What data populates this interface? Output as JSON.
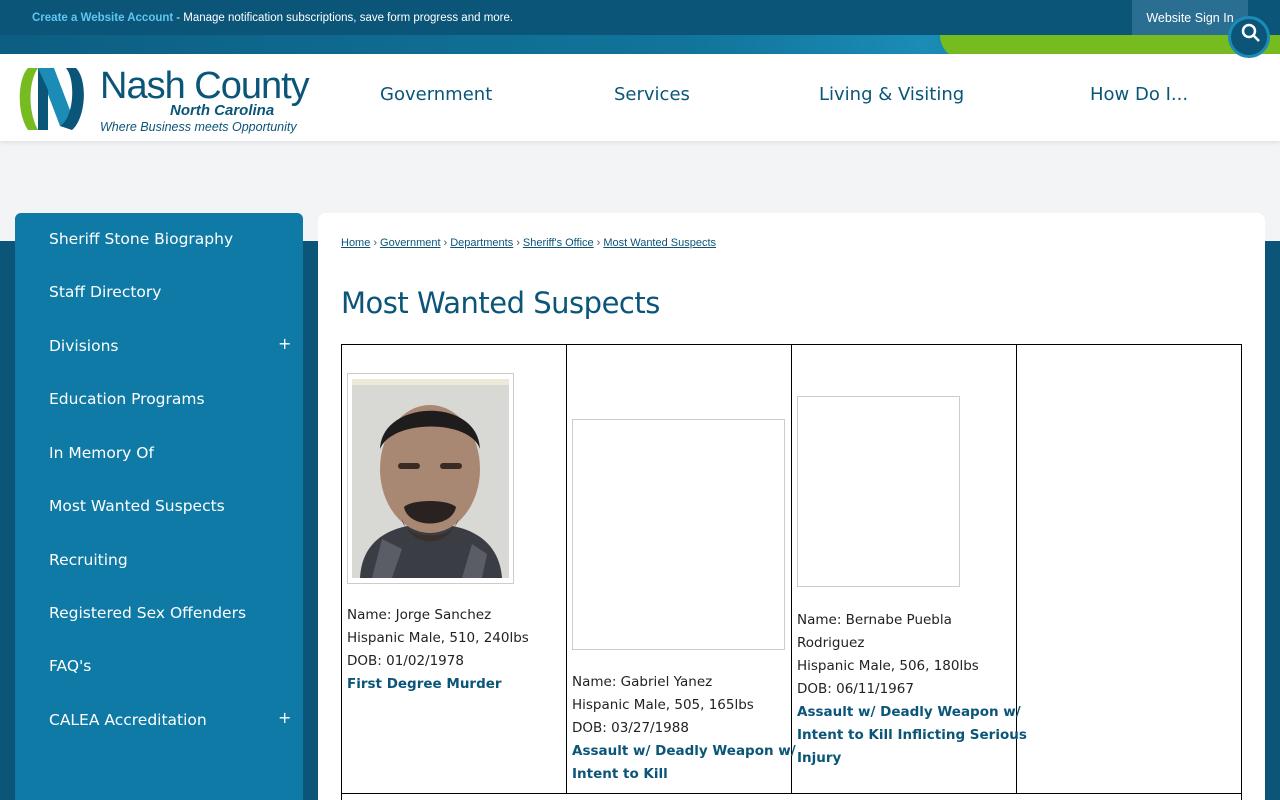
{
  "notify_bar": {
    "create_account": "Create a Website Account",
    "message": "- Manage notification subscriptions, save form progress and more.",
    "sign_in": "Website Sign In"
  },
  "logo": {
    "main": "Nash County",
    "sub": "North Carolina",
    "tagline": "Where Business meets Opportunity"
  },
  "main_nav": [
    "Government",
    "Services",
    "Living & Visiting",
    "How Do I..."
  ],
  "sidebar": {
    "items": [
      {
        "label": "Sheriff Stone Biography",
        "expandable": false
      },
      {
        "label": "Staff Directory",
        "expandable": false
      },
      {
        "label": "Divisions",
        "expandable": true
      },
      {
        "label": "Education Programs",
        "expandable": false
      },
      {
        "label": "In Memory Of",
        "expandable": false
      },
      {
        "label": "Most Wanted Suspects",
        "expandable": false
      },
      {
        "label": "Recruiting",
        "expandable": false
      },
      {
        "label": "Registered Sex Offenders",
        "expandable": false
      },
      {
        "label": "FAQ's",
        "expandable": false
      },
      {
        "label": "CALEA Accreditation",
        "expandable": true
      }
    ],
    "expand_symbol": "+"
  },
  "breadcrumb": [
    "Home",
    "Government",
    "Departments",
    "Sheriff's Office",
    "Most Wanted Suspects"
  ],
  "page_title": "Most Wanted Suspects",
  "suspects": [
    {
      "name": "Name: Jorge Sanchez",
      "description": "Hispanic Male, 510, 240lbs",
      "dob": "DOB: 01/02/1978",
      "crime": "First Degree Murder"
    },
    {
      "name": "Name:  Gabriel Yanez",
      "description": "Hispanic Male, 505, 165lbs",
      "dob": "DOB: 03/27/1988",
      "crime_line1": "Assault w/ Deadly Weapon w/",
      "crime_line2": "Intent to Kill"
    },
    {
      "name": "Name:  Bernabe Puebla",
      "name_line2": "Rodriguez",
      "description": "Hispanic Male, 506, 180lbs",
      "dob": "DOB: 06/11/1967",
      "crime_line1": "Assault w/ Deadly Weapon w/",
      "crime_line2": "Intent to Kill Inflicting Serious",
      "crime_line3": "Injury"
    }
  ]
}
